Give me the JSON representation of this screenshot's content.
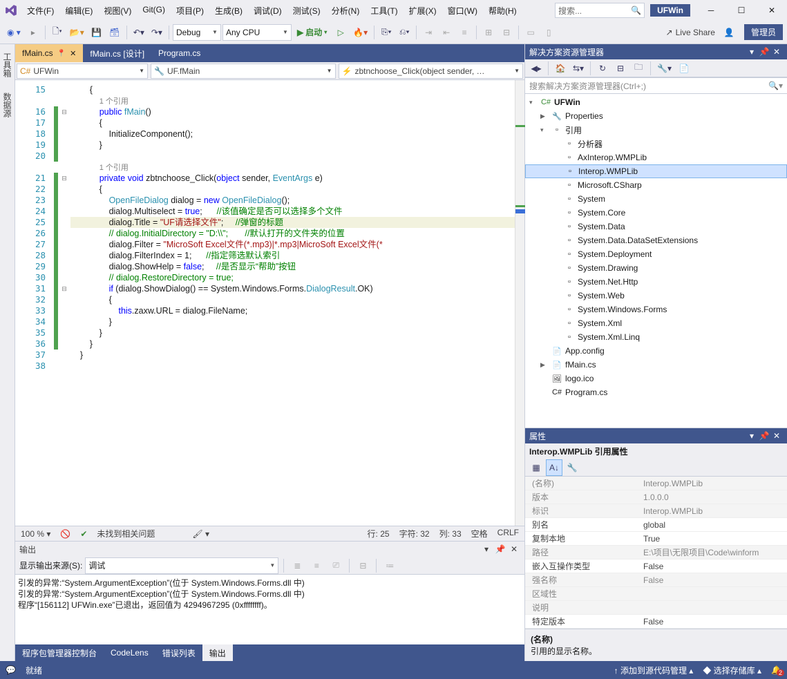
{
  "title": {
    "solution": "UFWin"
  },
  "search": {
    "placeholder": "搜索..."
  },
  "menu": [
    "文件(F)",
    "编辑(E)",
    "视图(V)",
    "Git(G)",
    "项目(P)",
    "生成(B)",
    "调试(D)",
    "测试(S)",
    "分析(N)",
    "工具(T)",
    "扩展(X)",
    "窗口(W)",
    "帮助(H)"
  ],
  "toolbar": {
    "config": "Debug",
    "platform": "Any CPU",
    "run_label": "启动",
    "live_share": "Live Share",
    "admin": "管理员"
  },
  "left_tabs": [
    "工具箱",
    "数据源"
  ],
  "doc_tabs": [
    {
      "label": "fMain.cs",
      "active": true,
      "pinned": true
    },
    {
      "label": "fMain.cs [设计]",
      "active": false
    },
    {
      "label": "Program.cs",
      "active": false
    }
  ],
  "crumbs": {
    "left": "UFWin",
    "mid": "UF.fMain",
    "right": "zbtnchoose_Click(object sender, …"
  },
  "editor": {
    "lines_start": 15,
    "lines": [
      {
        "n": 15,
        "txt": "        {"
      },
      {
        "n": null,
        "txt": "            <ref>1 个引用</ref>"
      },
      {
        "n": 16,
        "txt": "            <kw>public</kw> <typ>fMain</typ>()"
      },
      {
        "n": 17,
        "txt": "            {"
      },
      {
        "n": 18,
        "txt": "                InitializeComponent();"
      },
      {
        "n": 19,
        "txt": "            }"
      },
      {
        "n": 20,
        "txt": ""
      },
      {
        "n": null,
        "txt": "            <ref>1 个引用</ref>"
      },
      {
        "n": 21,
        "txt": "            <kw>private</kw> <kw>void</kw> zbtnchoose_Click(<kw>object</kw> sender, <typ>EventArgs</typ> e)"
      },
      {
        "n": 22,
        "txt": "            {"
      },
      {
        "n": 23,
        "txt": "                <typ>OpenFileDialog</typ> dialog = <kw>new</kw> <typ>OpenFileDialog</typ>();"
      },
      {
        "n": 24,
        "txt": "                dialog.Multiselect = <kw>true</kw>;      <cmt>//该值确定是否可以选择多个文件</cmt>"
      },
      {
        "n": 25,
        "hl": true,
        "txt": "                dialog.Title = <str>\"UF请选择文件\"</str>;     <cmt>//弹窗的标题</cmt>"
      },
      {
        "n": 26,
        "txt": "                <cmt>// dialog.InitialDirectory = \"D:\\\\\";       //默认打开的文件夹的位置</cmt>"
      },
      {
        "n": 27,
        "txt": "                dialog.Filter = <str>\"MicroSoft Excel文件(*.mp3)|*.mp3|MicroSoft Excel文件(*</str>"
      },
      {
        "n": 28,
        "txt": "                dialog.FilterIndex = 1;      <cmt>//指定筛选默认索引</cmt>"
      },
      {
        "n": 29,
        "txt": "                dialog.ShowHelp = <kw>false</kw>;     <cmt>//是否显示“帮助”按钮</cmt>"
      },
      {
        "n": 30,
        "txt": "                <cmt>// dialog.RestoreDirectory = true;</cmt>"
      },
      {
        "n": 31,
        "txt": "                <kw>if</kw> (dialog.ShowDialog() == System.Windows.Forms.<typ>DialogResult</typ>.OK)"
      },
      {
        "n": 32,
        "txt": "                {"
      },
      {
        "n": 33,
        "txt": "                    <kw>this</kw>.zaxw.URL = dialog.FileName;"
      },
      {
        "n": 34,
        "txt": "                }"
      },
      {
        "n": 35,
        "txt": "            }"
      },
      {
        "n": 36,
        "txt": "        }"
      },
      {
        "n": 37,
        "txt": "    }"
      },
      {
        "n": 38,
        "txt": ""
      }
    ],
    "status": {
      "zoom": "100 %",
      "issues": "未找到相关问题",
      "line": "行: 25",
      "char": "字符: 32",
      "col": "列: 33",
      "ins": "空格",
      "enc": "CRLF"
    }
  },
  "output": {
    "title": "输出",
    "source_label": "显示输出来源(S):",
    "source_value": "调试",
    "lines": [
      "引发的异常:“System.ArgumentException”(位于 System.Windows.Forms.dll 中)",
      "引发的异常:“System.ArgumentException”(位于 System.Windows.Forms.dll 中)",
      "程序“[156112] UFWin.exe”已退出，返回值为 4294967295 (0xffffffff)。"
    ]
  },
  "bottom_tabs": [
    {
      "label": "程序包管理器控制台",
      "active": false
    },
    {
      "label": "CodeLens",
      "active": false
    },
    {
      "label": "错误列表",
      "active": false
    },
    {
      "label": "输出",
      "active": true
    }
  ],
  "solution_explorer": {
    "title": "解决方案资源管理器",
    "search_placeholder": "搜索解决方案资源管理器(Ctrl+;)",
    "root": "UFWin",
    "nodes": [
      {
        "d": 1,
        "arr": "▶",
        "icon": "🔧",
        "label": "Properties"
      },
      {
        "d": 1,
        "arr": "▾",
        "icon": "▫",
        "label": "引用"
      },
      {
        "d": 2,
        "arr": "",
        "icon": "▫",
        "label": "分析器"
      },
      {
        "d": 2,
        "arr": "",
        "icon": "▫",
        "label": "AxInterop.WMPLib"
      },
      {
        "d": 2,
        "arr": "",
        "icon": "▫",
        "label": "Interop.WMPLib",
        "sel": true
      },
      {
        "d": 2,
        "arr": "",
        "icon": "▫",
        "label": "Microsoft.CSharp"
      },
      {
        "d": 2,
        "arr": "",
        "icon": "▫",
        "label": "System"
      },
      {
        "d": 2,
        "arr": "",
        "icon": "▫",
        "label": "System.Core"
      },
      {
        "d": 2,
        "arr": "",
        "icon": "▫",
        "label": "System.Data"
      },
      {
        "d": 2,
        "arr": "",
        "icon": "▫",
        "label": "System.Data.DataSetExtensions"
      },
      {
        "d": 2,
        "arr": "",
        "icon": "▫",
        "label": "System.Deployment"
      },
      {
        "d": 2,
        "arr": "",
        "icon": "▫",
        "label": "System.Drawing"
      },
      {
        "d": 2,
        "arr": "",
        "icon": "▫",
        "label": "System.Net.Http"
      },
      {
        "d": 2,
        "arr": "",
        "icon": "▫",
        "label": "System.Web"
      },
      {
        "d": 2,
        "arr": "",
        "icon": "▫",
        "label": "System.Windows.Forms"
      },
      {
        "d": 2,
        "arr": "",
        "icon": "▫",
        "label": "System.Xml"
      },
      {
        "d": 2,
        "arr": "",
        "icon": "▫",
        "label": "System.Xml.Linq"
      },
      {
        "d": 1,
        "arr": "",
        "icon": "📄",
        "label": "App.config"
      },
      {
        "d": 1,
        "arr": "▶",
        "icon": "📄",
        "label": "fMain.cs"
      },
      {
        "d": 1,
        "arr": "",
        "icon": "🖼",
        "label": "logo.ico"
      },
      {
        "d": 1,
        "arr": "",
        "icon": "C#",
        "label": "Program.cs"
      }
    ]
  },
  "properties": {
    "title": "属性",
    "object": "Interop.WMPLib 引用属性",
    "rows": [
      {
        "k": "(名称)",
        "v": "Interop.WMPLib",
        "ro": true
      },
      {
        "k": "版本",
        "v": "1.0.0.0",
        "ro": true
      },
      {
        "k": "标识",
        "v": "Interop.WMPLib",
        "ro": true
      },
      {
        "k": "别名",
        "v": "global"
      },
      {
        "k": "复制本地",
        "v": "True"
      },
      {
        "k": "路径",
        "v": "E:\\项目\\无限项目\\Code\\winform",
        "ro": true
      },
      {
        "k": "嵌入互操作类型",
        "v": "False"
      },
      {
        "k": "强名称",
        "v": "False",
        "ro": true
      },
      {
        "k": "区域性",
        "v": "",
        "ro": true
      },
      {
        "k": "说明",
        "v": "",
        "ro": true
      },
      {
        "k": "特定版本",
        "v": "False"
      }
    ],
    "desc_title": "(名称)",
    "desc_text": "引用的显示名称。"
  },
  "statusbar": {
    "ready": "就绪",
    "scm": "添加到源代码管理",
    "repo": "选择存储库",
    "bell_count": "2"
  }
}
